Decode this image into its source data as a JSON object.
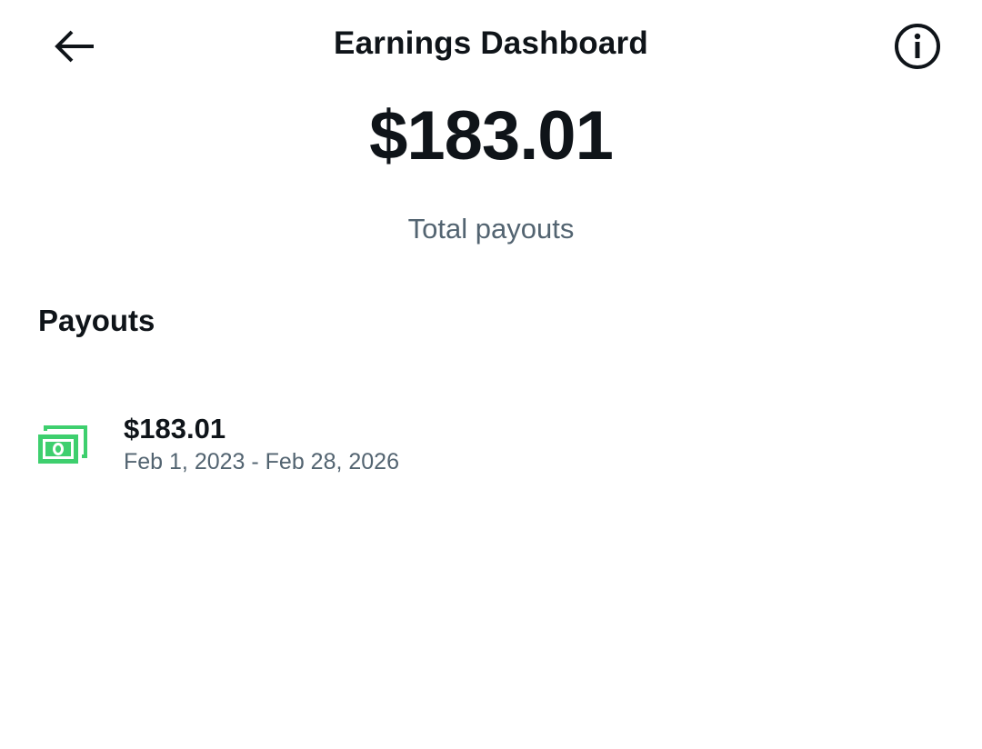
{
  "header": {
    "title": "Earnings Dashboard",
    "back_icon": "arrow-left-icon",
    "info_icon": "info-circle-icon"
  },
  "summary": {
    "total_amount": "$183.01",
    "total_label": "Total payouts"
  },
  "payouts": {
    "section_title": "Payouts",
    "items": [
      {
        "icon": "money-stack-icon",
        "amount": "$183.01",
        "date_range": "Feb 1, 2023 - Feb 28, 2026"
      }
    ]
  },
  "colors": {
    "text_primary": "#0f1419",
    "text_secondary": "#536471",
    "money_icon": "#3ecf6e",
    "background": "#ffffff"
  }
}
